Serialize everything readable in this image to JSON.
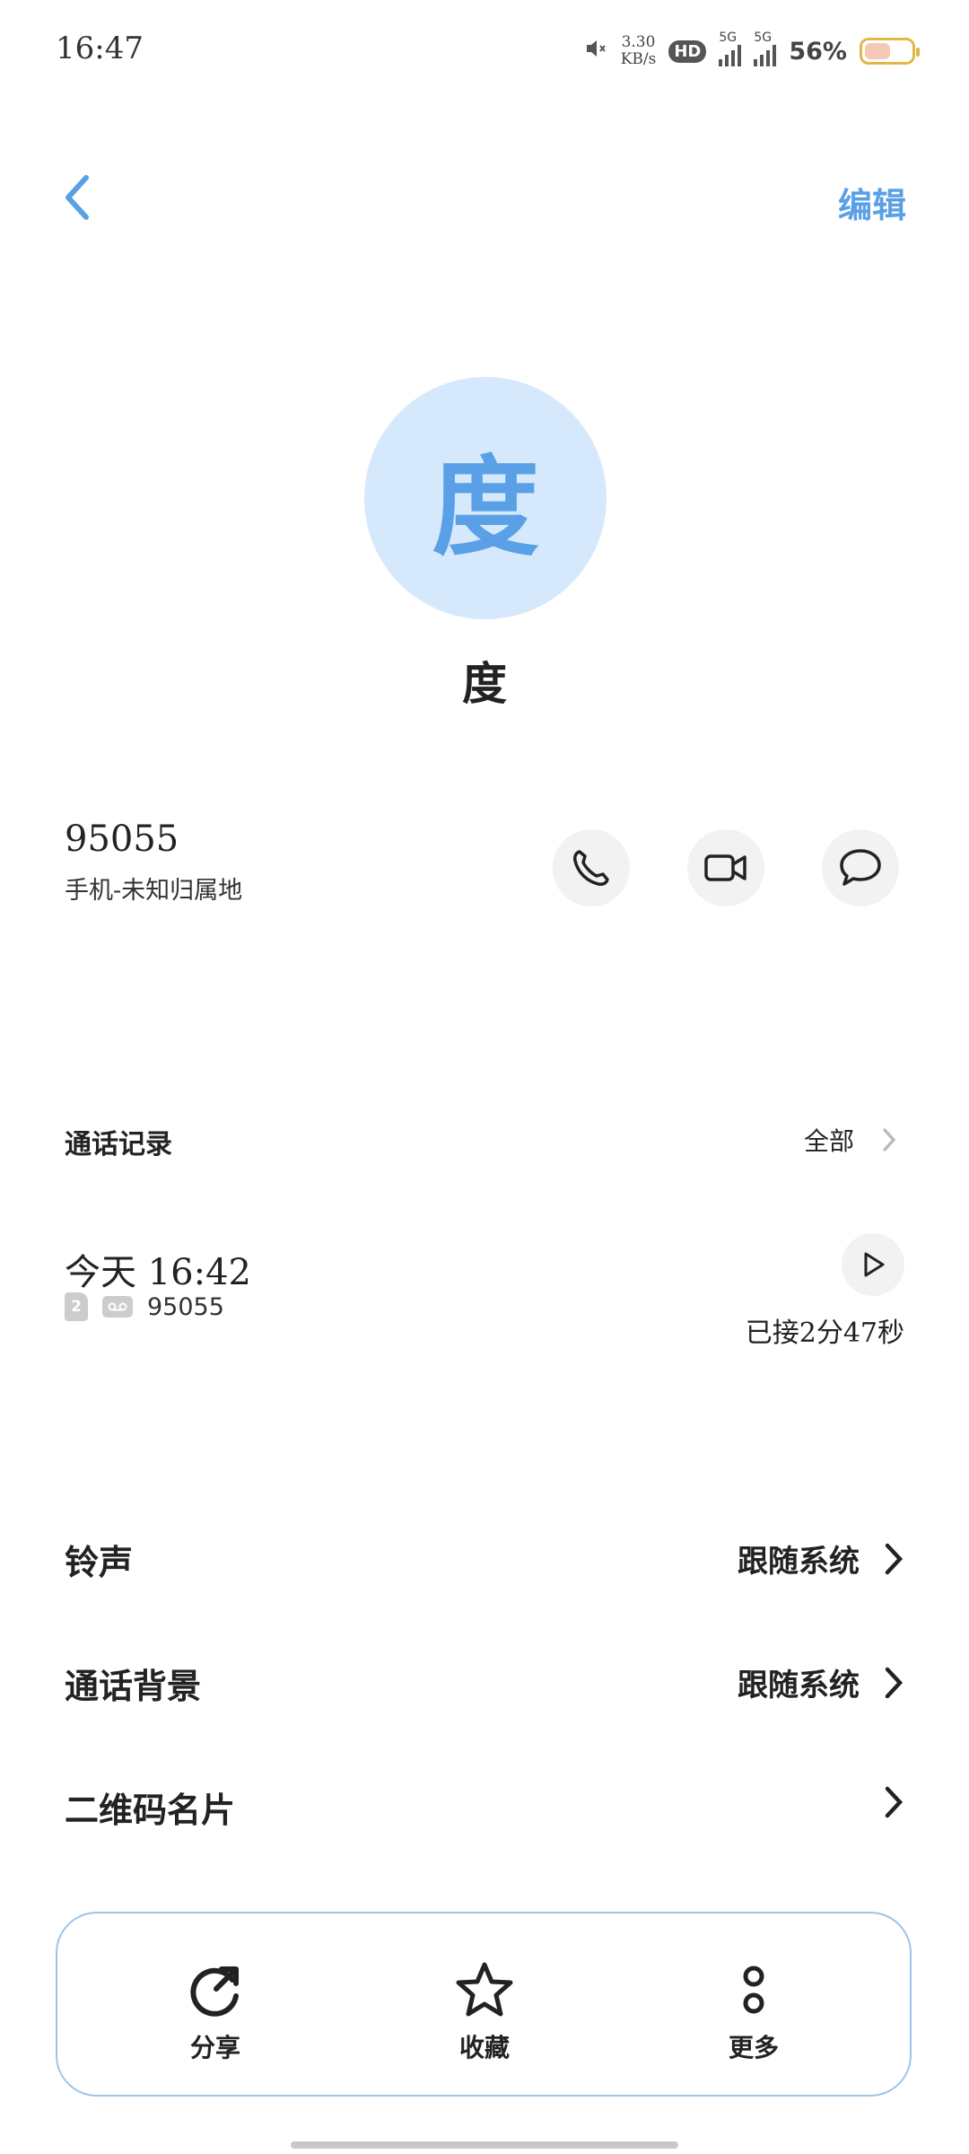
{
  "status": {
    "time": "16:47",
    "speed_value": "3.30",
    "speed_unit": "KB/s",
    "hd": "HD",
    "sim1": "5G",
    "sim2": "5G",
    "battery_pct": "56%"
  },
  "header": {
    "edit_label": "编辑"
  },
  "contact": {
    "avatar_char": "度",
    "name": "度",
    "number": "95055",
    "number_desc": "手机-未知归属地"
  },
  "call_log": {
    "title": "通话记录",
    "all_label": "全部",
    "entries": [
      {
        "time": "今天 16:42",
        "sim": "2",
        "number": "95055",
        "duration": "已接2分47秒"
      }
    ]
  },
  "settings": [
    {
      "label": "铃声",
      "value": "跟随系统"
    },
    {
      "label": "通话背景",
      "value": "跟随系统"
    },
    {
      "label": "二维码名片",
      "value": ""
    }
  ],
  "bottom": {
    "share": "分享",
    "favorite": "收藏",
    "more": "更多"
  },
  "colors": {
    "accent": "#5aa0e6",
    "avatar_bg": "#d6e8fb",
    "border": "#9cc4ea"
  }
}
